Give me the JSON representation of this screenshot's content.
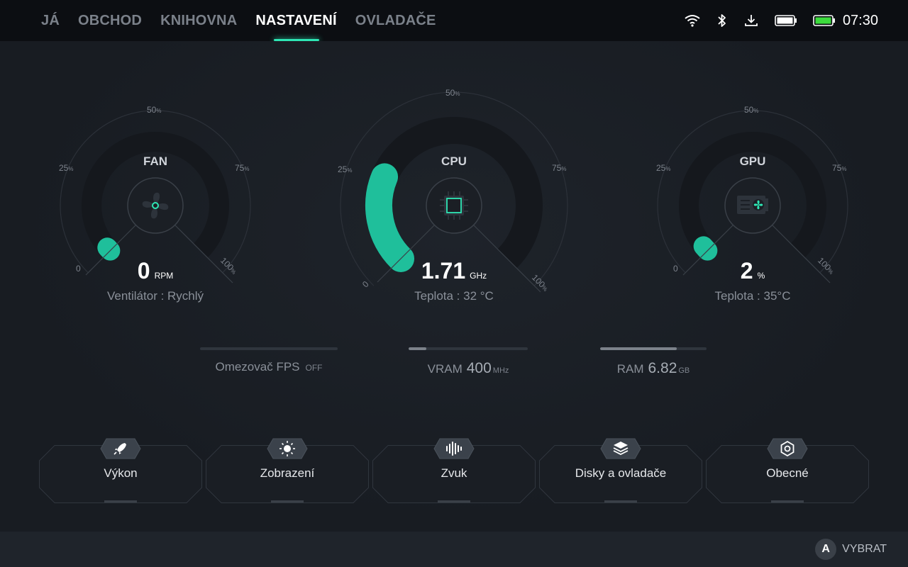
{
  "nav": {
    "tabs": [
      {
        "label": "JÁ"
      },
      {
        "label": "OBCHOD"
      },
      {
        "label": "KNIHOVNA"
      },
      {
        "label": "NASTAVENÍ"
      },
      {
        "label": "OVLADAČE"
      }
    ],
    "active_index": 3
  },
  "status": {
    "time": "07:30",
    "icons": [
      "wifi-icon",
      "bluetooth-icon",
      "download-icon",
      "controller-battery-icon",
      "battery-icon"
    ]
  },
  "gauges": {
    "fan": {
      "title": "FAN",
      "value": "0",
      "unit": "RPM",
      "sub": "Ventilátor : Rychlý",
      "level_pct": 0,
      "icon": "fan-icon"
    },
    "cpu": {
      "title": "CPU",
      "value": "1.71",
      "unit": "GHz",
      "sub": "Teplota : 32 °C",
      "level_pct": 25,
      "icon": "chip-icon"
    },
    "gpu": {
      "title": "GPU",
      "value": "2",
      "unit": "%",
      "sub": "Teplota : 35°C",
      "level_pct": 2,
      "icon": "gpu-card-icon"
    },
    "tick_labels": {
      "t0": "0",
      "t25": "25",
      "t50": "50",
      "t75": "75",
      "t100": "100",
      "pct": "%"
    }
  },
  "metrics": {
    "fps": {
      "label": "Omezovač FPS",
      "value": "OFF",
      "unit": "",
      "level_pct": 0
    },
    "vram": {
      "label": "VRAM",
      "value": "400",
      "unit": "MHz",
      "level_pct": 15
    },
    "ram": {
      "label": "RAM",
      "value": "6.82",
      "unit": "GB",
      "level_pct": 72
    }
  },
  "cards": [
    {
      "label": "Výkon",
      "icon": "rocket-icon"
    },
    {
      "label": "Zobrazení",
      "icon": "brightness-icon"
    },
    {
      "label": "Zvuk",
      "icon": "sound-wave-icon"
    },
    {
      "label": "Disky a ovladače",
      "icon": "layers-icon"
    },
    {
      "label": "Obecné",
      "icon": "settings-hex-icon"
    }
  ],
  "footer": {
    "button": "A",
    "hint": "VYBRAT"
  },
  "colors": {
    "accent": "#2ee6b4",
    "background": "#181c22",
    "topbar": "#0c0e12"
  }
}
